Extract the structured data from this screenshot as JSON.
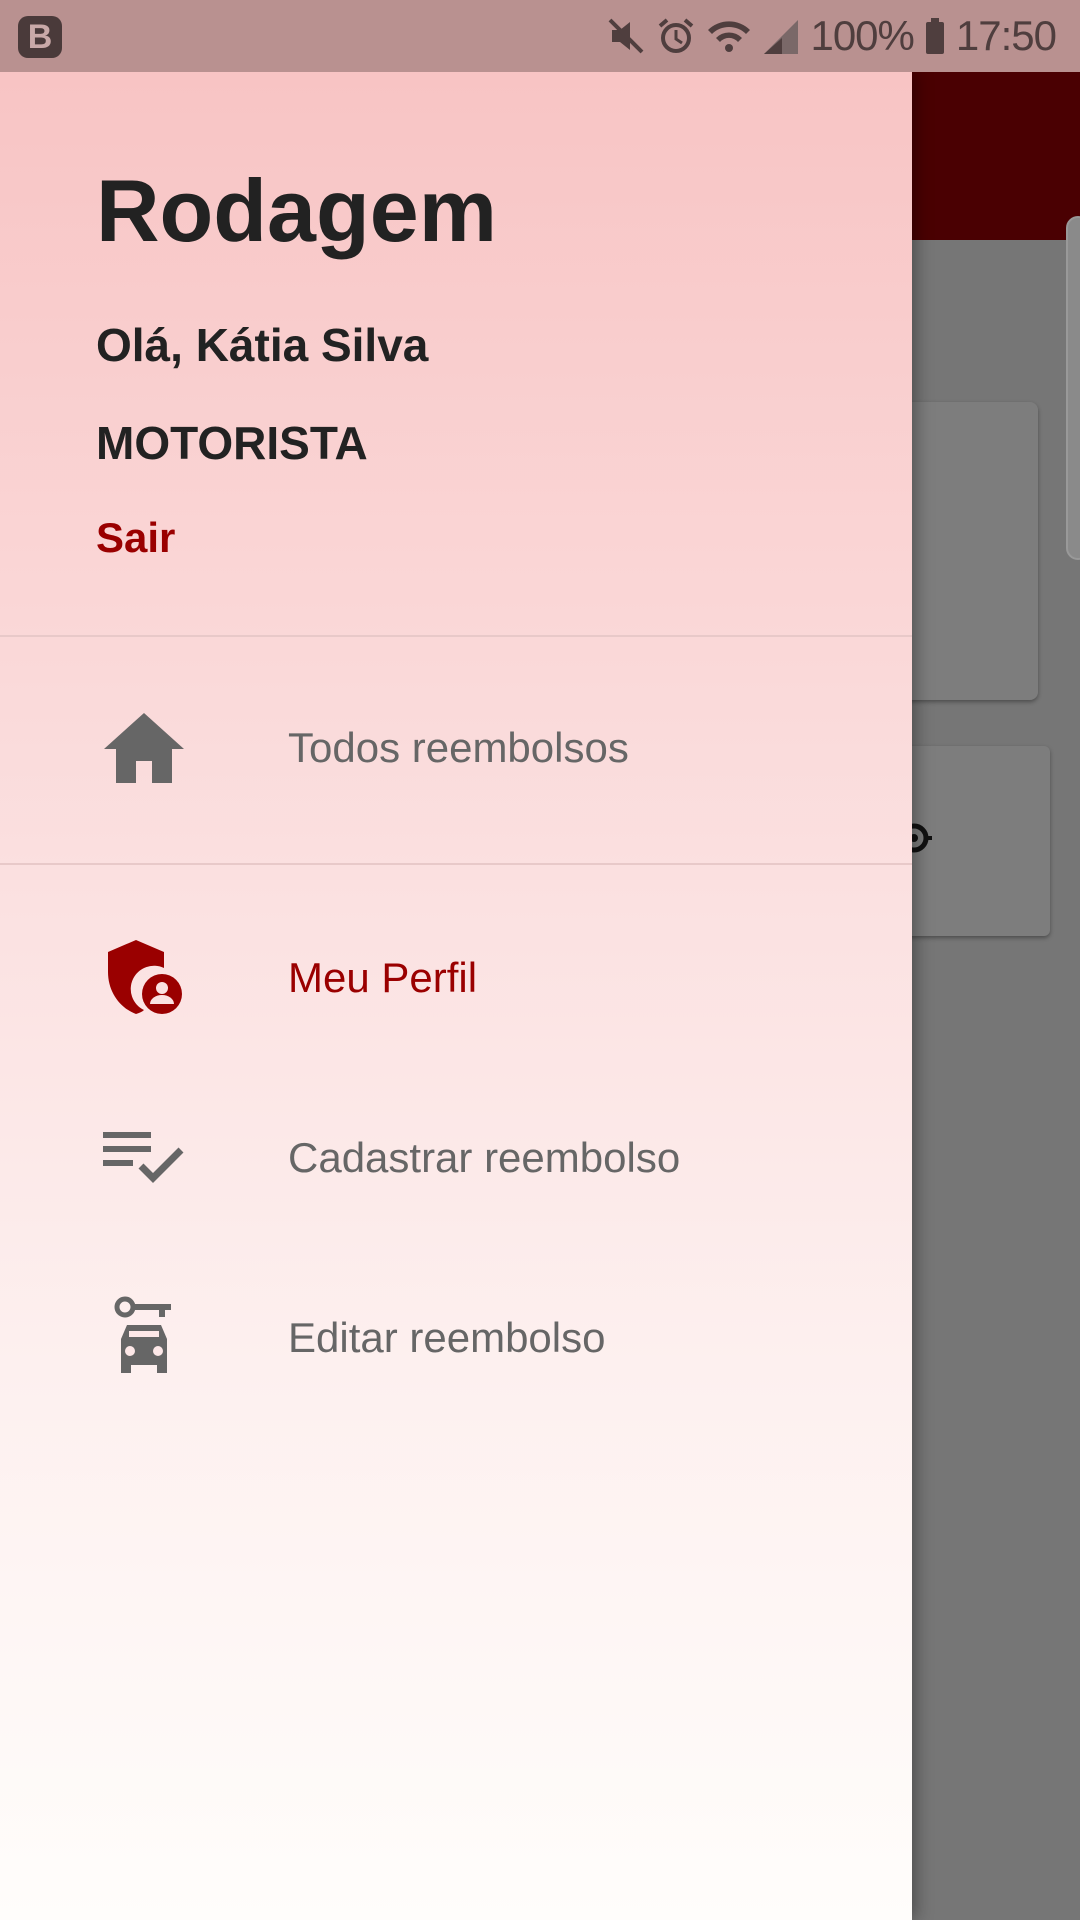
{
  "status_bar": {
    "battery": "100%",
    "time": "17:50",
    "app_icon_letter": "B"
  },
  "drawer": {
    "title": "Rodagem",
    "greeting": "Olá, Kátia Silva",
    "role": "MOTORISTA",
    "logout_label": "Sair",
    "items": [
      {
        "label": "Todos reembolsos",
        "icon": "home-icon",
        "active": false
      },
      {
        "label": "Meu Perfil",
        "icon": "shield-account-icon",
        "active": true
      },
      {
        "label": "Cadastrar reembolso",
        "icon": "playlist-check-icon",
        "active": false
      },
      {
        "label": "Editar reembolso",
        "icon": "car-key-icon",
        "active": false
      }
    ]
  },
  "colors": {
    "accent": "#9a0000",
    "appbar": "#4a0002",
    "text": "#222222",
    "menu_text": "#666666"
  }
}
